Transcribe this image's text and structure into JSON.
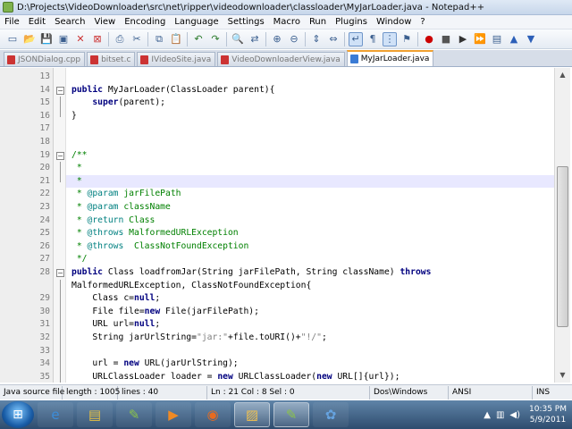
{
  "window": {
    "title": "D:\\Projects\\VideoDownloader\\src\\net\\ripper\\videodownloader\\classloader\\MyJarLoader.java - Notepad++"
  },
  "menu": [
    "File",
    "Edit",
    "Search",
    "View",
    "Encoding",
    "Language",
    "Settings",
    "Macro",
    "Run",
    "Plugins",
    "Window",
    "?"
  ],
  "toolbar_icons": [
    "new-file-icon",
    "open-file-icon",
    "save-icon",
    "save-all-icon",
    "close-icon",
    "close-all-icon",
    "print-icon",
    "cut-icon",
    "copy-icon",
    "paste-icon",
    "undo-icon",
    "redo-icon",
    "find-icon",
    "replace-icon",
    "zoom-in-icon",
    "zoom-out-icon",
    "sync-v-icon",
    "sync-h-icon",
    "wrap-icon",
    "show-all-icon",
    "indent-guide-icon",
    "user-lang-icon",
    "macro-record-icon",
    "macro-stop-icon",
    "macro-play-icon",
    "macro-run-multi-icon",
    "macro-save-icon",
    "spell-up-icon",
    "spell-down-icon"
  ],
  "tabs": [
    {
      "label": "JSONDialog.cpp",
      "active": false
    },
    {
      "label": "bitset.c",
      "active": false
    },
    {
      "label": "IVideoSite.java",
      "active": false
    },
    {
      "label": "VideoDownloaderView.java",
      "active": false
    },
    {
      "label": "MyJarLoader.java",
      "active": true
    }
  ],
  "editor": {
    "current_line": 21,
    "lines": [
      {
        "n": "13",
        "tokens": []
      },
      {
        "n": "14",
        "tokens": [
          [
            "kw",
            "public"
          ],
          [
            "t",
            " MyJarLoader(ClassLoader parent){"
          ]
        ],
        "indent": 0
      },
      {
        "n": "15",
        "tokens": [
          [
            "t",
            "    "
          ],
          [
            "kw",
            "super"
          ],
          [
            "t",
            "(parent);"
          ]
        ],
        "indent": 0
      },
      {
        "n": "16",
        "tokens": [
          [
            "t",
            "}"
          ]
        ],
        "indent": 0
      },
      {
        "n": "17",
        "tokens": []
      },
      {
        "n": "18",
        "tokens": []
      },
      {
        "n": "19",
        "tokens": [
          [
            "cm",
            "/**"
          ]
        ],
        "indent": 0
      },
      {
        "n": "20",
        "tokens": [
          [
            "cm",
            " *"
          ]
        ],
        "indent": 0
      },
      {
        "n": "21",
        "tokens": [
          [
            "cm",
            " *"
          ]
        ],
        "indent": 0
      },
      {
        "n": "22",
        "tokens": [
          [
            "cm",
            " * "
          ],
          [
            "tag",
            "@param"
          ],
          [
            "cm",
            " jarFilePath"
          ]
        ]
      },
      {
        "n": "23",
        "tokens": [
          [
            "cm",
            " * "
          ],
          [
            "tag",
            "@param"
          ],
          [
            "cm",
            " className"
          ]
        ]
      },
      {
        "n": "24",
        "tokens": [
          [
            "cm",
            " * "
          ],
          [
            "tag",
            "@return"
          ],
          [
            "cm",
            " Class"
          ]
        ]
      },
      {
        "n": "25",
        "tokens": [
          [
            "cm",
            " * "
          ],
          [
            "tag",
            "@throws"
          ],
          [
            "cm",
            " MalformedURLException"
          ]
        ]
      },
      {
        "n": "26",
        "tokens": [
          [
            "cm",
            " * "
          ],
          [
            "tag",
            "@throws"
          ],
          [
            "cm",
            "  ClassNotFoundException"
          ]
        ]
      },
      {
        "n": "27",
        "tokens": [
          [
            "cm",
            " */"
          ]
        ]
      },
      {
        "n": "28",
        "tokens": [
          [
            "kw",
            "public"
          ],
          [
            "t",
            " Class loadfromJar(String jarFilePath, String className) "
          ],
          [
            "kw",
            "throws"
          ]
        ]
      },
      {
        "n": "",
        "tokens": [
          [
            "t",
            "MalformedURLException, ClassNotFoundException{"
          ]
        ]
      },
      {
        "n": "29",
        "tokens": [
          [
            "t",
            "    Class c="
          ],
          [
            "kw",
            "null"
          ],
          [
            "t",
            ";"
          ]
        ]
      },
      {
        "n": "30",
        "tokens": [
          [
            "t",
            "    File file="
          ],
          [
            "kw",
            "new"
          ],
          [
            "t",
            " File(jarFilePath);"
          ]
        ]
      },
      {
        "n": "31",
        "tokens": [
          [
            "t",
            "    URL url="
          ],
          [
            "kw",
            "null"
          ],
          [
            "t",
            ";"
          ]
        ]
      },
      {
        "n": "32",
        "tokens": [
          [
            "t",
            "    String jarUrlString="
          ],
          [
            "str",
            "\"jar:\""
          ],
          [
            "t",
            "+file.toURI()+"
          ],
          [
            "str",
            "\"!/\""
          ],
          [
            "t",
            ";"
          ]
        ]
      },
      {
        "n": "33",
        "tokens": []
      },
      {
        "n": "34",
        "tokens": [
          [
            "t",
            "    url = "
          ],
          [
            "kw",
            "new"
          ],
          [
            "t",
            " URL(jarUrlString);"
          ]
        ]
      },
      {
        "n": "35",
        "tokens": [
          [
            "t",
            "    URLClassLoader loader = "
          ],
          [
            "kw",
            "new"
          ],
          [
            "t",
            " URLClassLoader("
          ],
          [
            "kw",
            "new"
          ],
          [
            "t",
            " URL[]{url});"
          ]
        ]
      }
    ]
  },
  "status": {
    "language": "Java source file",
    "length": "length : 1005",
    "lines": "lines : 40",
    "position": "Ln : 21   Col : 8   Sel : 0",
    "eol": "Dos\\Windows",
    "encoding": "ANSI",
    "mode": "INS"
  },
  "taskbar": {
    "apps": [
      "ie-icon",
      "explorer-icon",
      "notepadpp-icon",
      "media-player-icon",
      "firefox-icon",
      "paint-icon",
      "notepadpp-window-icon",
      "paint-brush-icon"
    ],
    "time": "10:35 PM",
    "date": "5/9/2011"
  }
}
